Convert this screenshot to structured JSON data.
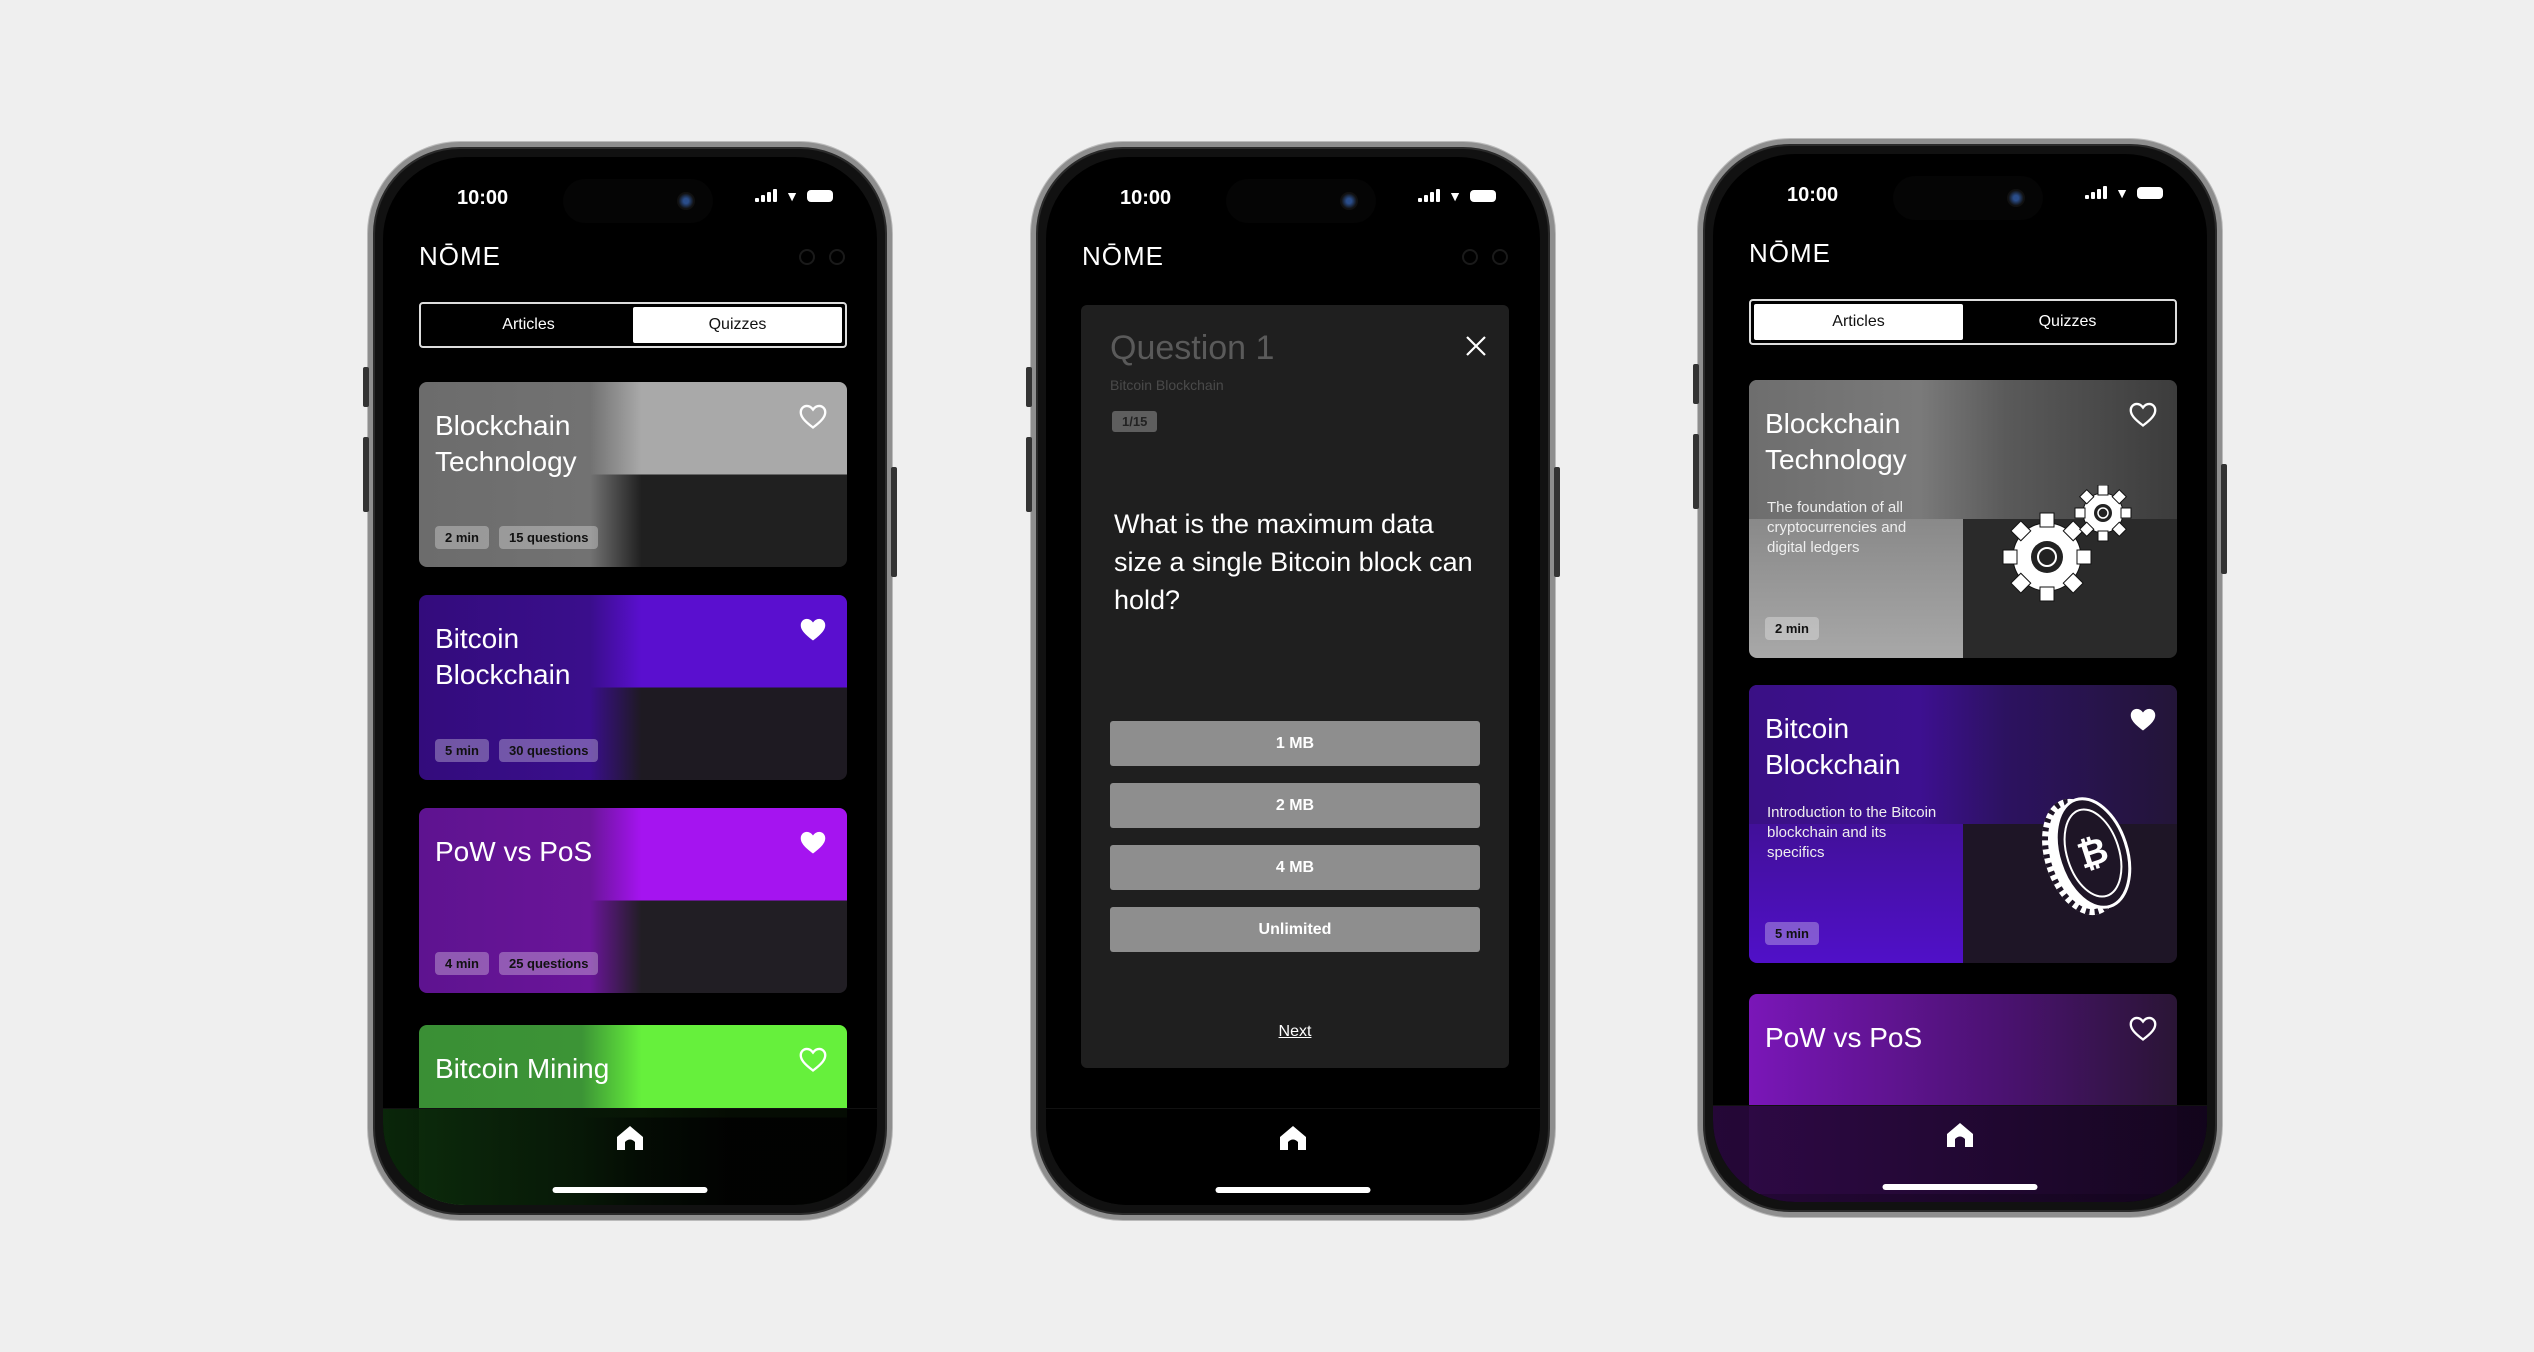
{
  "status": {
    "time": "10:00"
  },
  "app": {
    "logo": "NŌME"
  },
  "tabs": {
    "articles": "Articles",
    "quizzes": "Quizzes"
  },
  "phone1": {
    "active_tab": "Quizzes",
    "cards": [
      {
        "title": "Blockchain Technology",
        "time": "2 min",
        "questions": "15 questions",
        "favorite": false
      },
      {
        "title": "Bitcoin Blockchain",
        "time": "5 min",
        "questions": "30 questions",
        "favorite": true
      },
      {
        "title": "PoW vs PoS",
        "time": "4 min",
        "questions": "25 questions",
        "favorite": true
      },
      {
        "title": "Bitcoin Mining",
        "favorite": false
      }
    ]
  },
  "phone2": {
    "title": "Question 1",
    "subtitle": "Bitcoin Blockchain",
    "progress": "1/15",
    "question": "What is the maximum data size a single Bitcoin block can hold?",
    "answers": [
      "1 MB",
      "2 MB",
      "4 MB",
      "Unlimited"
    ],
    "next": "Next"
  },
  "phone3": {
    "active_tab": "Articles",
    "cards": [
      {
        "title": "Blockchain Technology",
        "description": "The foundation of all cryptocurrencies and digital ledgers",
        "time": "2 min",
        "favorite": false,
        "icon": "gears-icon"
      },
      {
        "title": "Bitcoin Blockchain",
        "description": "Introduction to the Bitcoin blockchain and its specifics",
        "time": "5 min",
        "favorite": true,
        "icon": "bitcoin-coin-icon"
      },
      {
        "title": "PoW vs PoS",
        "favorite": false
      }
    ]
  },
  "colors": {
    "background": "#efefef",
    "screen": "#000000",
    "quiz_panel": "#1f1f1f",
    "answer": "#8e8e8e",
    "purple": "#5a0fcf",
    "violet": "#a514f0",
    "green": "#66f03c"
  }
}
